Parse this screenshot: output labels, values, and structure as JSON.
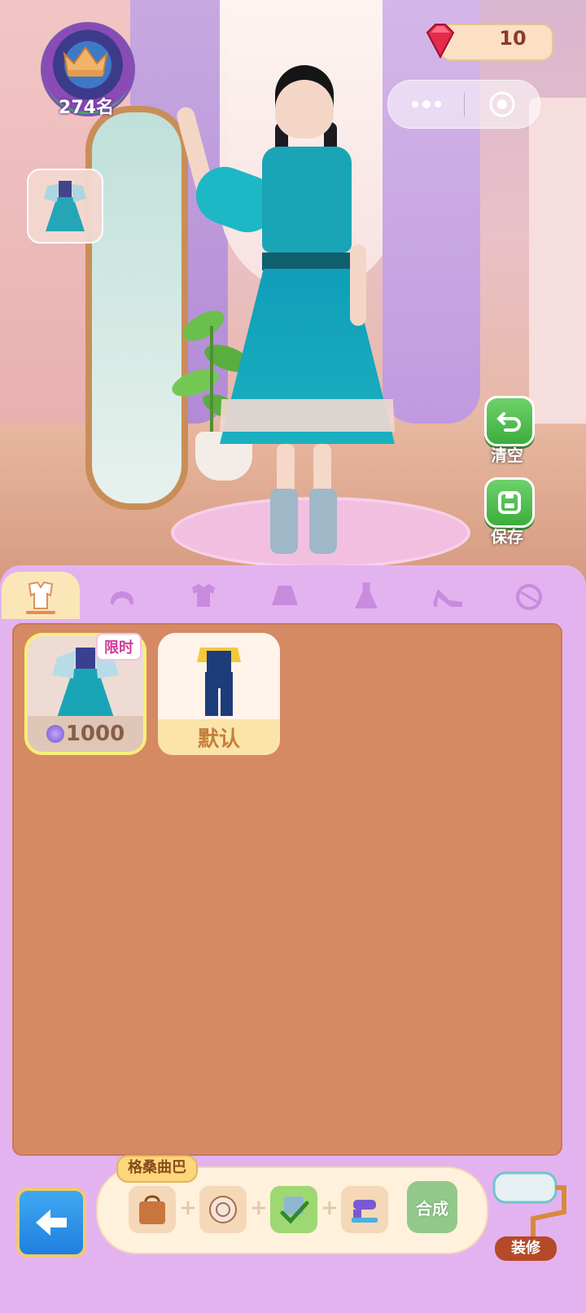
{
  "top": {
    "rank": "274名",
    "gems": "10"
  },
  "side_actions": {
    "clear_label": "清空",
    "save_label": "保存"
  },
  "tabs": [
    {
      "name": "suit",
      "icon": "suit-icon",
      "active": true
    },
    {
      "name": "hair",
      "icon": "hair-icon",
      "active": false
    },
    {
      "name": "top",
      "icon": "shirt-icon",
      "active": false
    },
    {
      "name": "skirt",
      "icon": "skirt-icon",
      "active": false
    },
    {
      "name": "dress",
      "icon": "dress-icon",
      "active": false
    },
    {
      "name": "shoes",
      "icon": "high-heel-icon",
      "active": false
    },
    {
      "name": "accessory",
      "icon": "accessory-icon",
      "active": false
    }
  ],
  "items": [
    {
      "tag": "限时",
      "price": "1000",
      "selected": true
    },
    {
      "label": "默认",
      "selected": false
    }
  ],
  "bottom": {
    "outfit_name": "格桑曲巴",
    "combine_label": "合成",
    "decorate_label": "装修"
  },
  "colors": {
    "panel": "#e3b3f0",
    "grid": "#d58a63",
    "accent_green": "#3bae3d",
    "back_blue": "#1f7fdf"
  }
}
